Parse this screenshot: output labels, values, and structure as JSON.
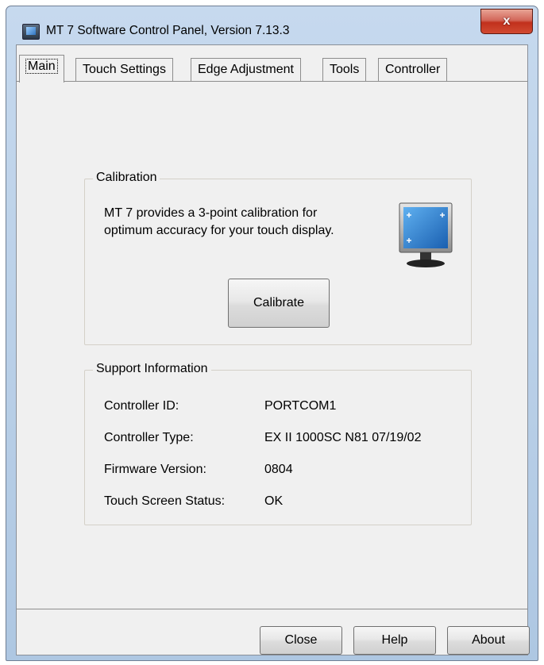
{
  "window": {
    "title": "MT 7 Software Control Panel, Version 7.13.3",
    "close_label": "x"
  },
  "tabs": [
    {
      "label": "Main",
      "active": true
    },
    {
      "label": "Touch Settings"
    },
    {
      "label": "Edge Adjustment"
    },
    {
      "label": "Tools"
    },
    {
      "label": "Controller"
    }
  ],
  "calibration": {
    "group_label": "Calibration",
    "description": "MT 7 provides a 3-point calibration for optimum accuracy for your touch display.",
    "button_label": "Calibrate",
    "icon": "touch-monitor-icon"
  },
  "support": {
    "group_label": "Support Information",
    "rows": [
      {
        "label": "Controller ID:",
        "value": "PORTCOM1"
      },
      {
        "label": "Controller Type:",
        "value": "EX II 1000SC N81 07/19/02"
      },
      {
        "label": "Firmware Version:",
        "value": "0804"
      },
      {
        "label": "Touch Screen Status:",
        "value": "OK"
      }
    ]
  },
  "footer": {
    "close_label": "Close",
    "help_label": "Help",
    "about_label": "About"
  },
  "colors": {
    "window_frame": "#aec7e2",
    "close_button": "#c1301c",
    "panel_bg": "#f0f0f0"
  }
}
